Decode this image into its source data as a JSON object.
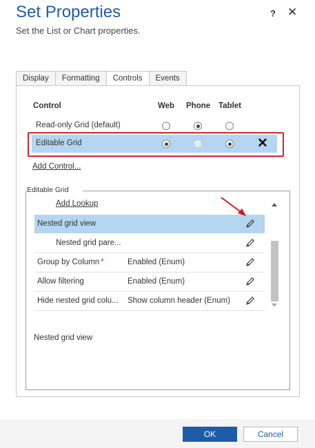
{
  "header": {
    "title": "Set Properties",
    "subtitle": "Set the List or Chart properties.",
    "help_label": "?",
    "close_label": "✕"
  },
  "tabs": [
    {
      "label": "Display",
      "active": false
    },
    {
      "label": "Formatting",
      "active": false
    },
    {
      "label": "Controls",
      "active": true
    },
    {
      "label": "Events",
      "active": false
    }
  ],
  "controls_table": {
    "headers": {
      "control": "Control",
      "web": "Web",
      "phone": "Phone",
      "tablet": "Tablet"
    },
    "rows": [
      {
        "name": "Read-only Grid (default)",
        "web": "unchecked",
        "phone": "checked",
        "tablet": "unchecked",
        "selected": false
      },
      {
        "name": "Editable Grid",
        "web": "checked",
        "phone": "disabled",
        "tablet": "checked",
        "selected": true,
        "remove_label": "✕"
      }
    ],
    "add_control_label": "Add Control..."
  },
  "editable_grid": {
    "legend": "Editable Grid",
    "add_lookup_label": "Add Lookup",
    "properties": [
      {
        "name": "Nested grid view",
        "value": "",
        "required": false,
        "selected": true
      },
      {
        "name": "Nested grid pare...",
        "value": "",
        "required": false,
        "selected": false,
        "indent": true
      },
      {
        "name": "Group by Column",
        "value": "Enabled (Enum)",
        "required": true,
        "selected": false
      },
      {
        "name": "Allow filtering",
        "value": "Enabled (Enum)",
        "required": false,
        "selected": false
      },
      {
        "name": "Hide nested grid colu...",
        "value": "Show column header (Enum)",
        "required": false,
        "selected": false
      }
    ],
    "required_marker": "*",
    "description": "Nested grid view"
  },
  "footer": {
    "ok_label": "OK",
    "cancel_label": "Cancel"
  },
  "colors": {
    "accent": "#1e5ca8",
    "selection": "#b4d6f0",
    "highlight_box": "#d9202c"
  }
}
